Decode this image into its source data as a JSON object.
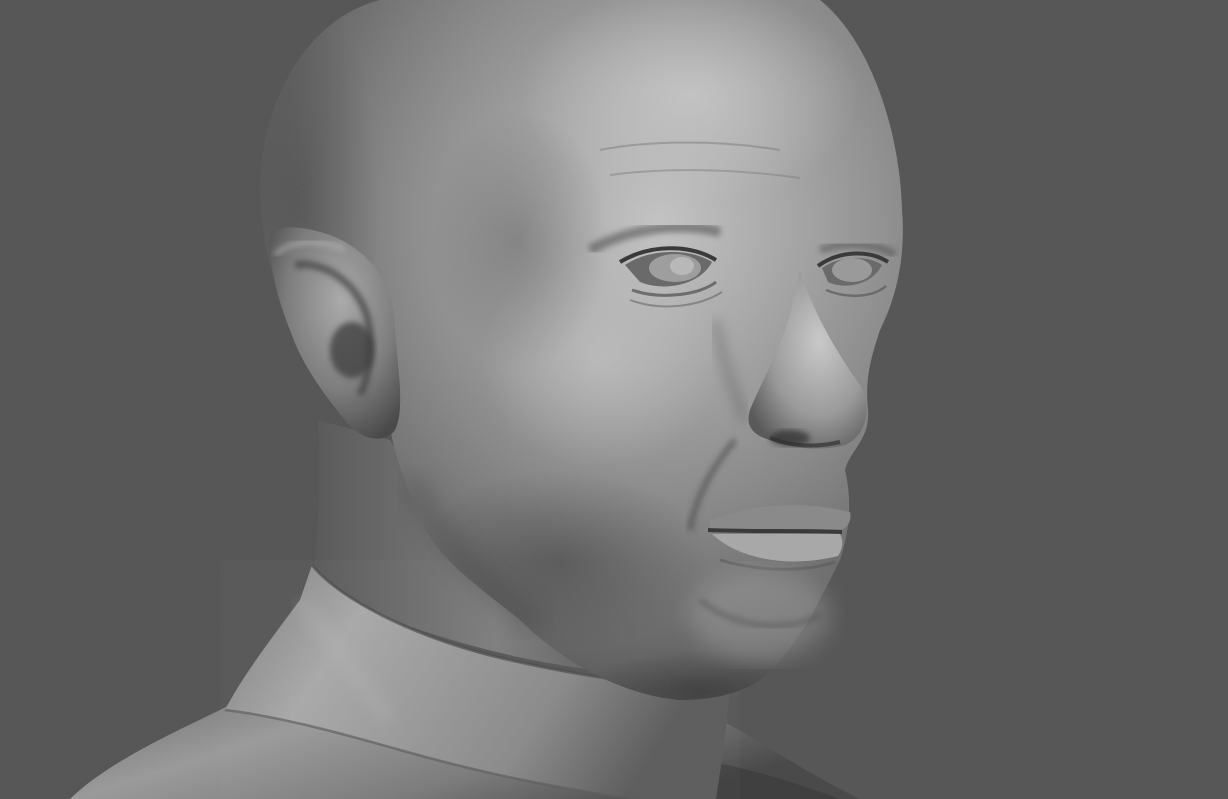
{
  "scene": {
    "description_label": "",
    "subject": "sculpted-head-bust",
    "colors": {
      "background": "#575757",
      "clay_highlight": "#b9b9b9",
      "clay_mid": "#8a8a8a",
      "clay_shadow": "#3e3e3e",
      "clay_deep": "#2c2c2c"
    }
  }
}
